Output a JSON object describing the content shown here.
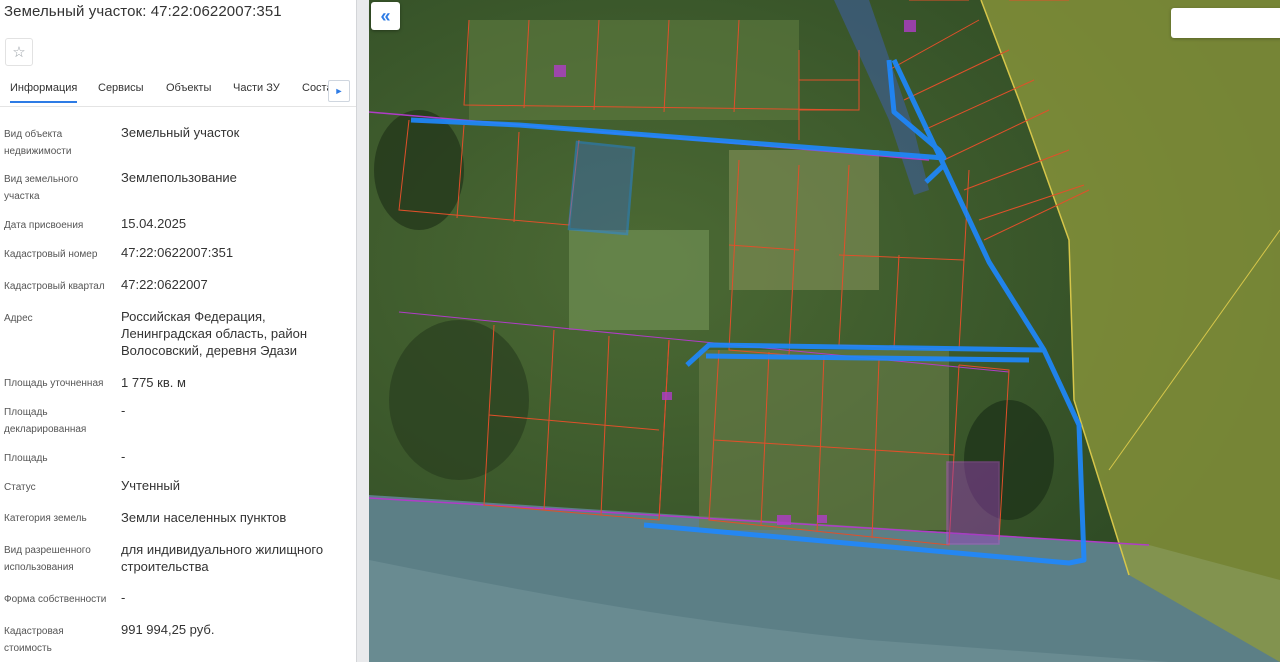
{
  "panel": {
    "title": "Земельный участок: 47:22:0622007:351",
    "favorite_icon": "star-icon",
    "tabs": [
      "Информация",
      "Сервисы",
      "Объекты",
      "Части ЗУ",
      "Соста"
    ],
    "tabs_next_icon": "chevron-right-icon",
    "rows": [
      {
        "label": "Вид объекта недвижимости",
        "value": "Земельный участок"
      },
      {
        "label": "Вид земельного участка",
        "value": "Землепользование"
      },
      {
        "label": "Дата присвоения",
        "value": "15.04.2025"
      },
      {
        "label": "Кадастровый номер",
        "value": "47:22:0622007:351"
      },
      {
        "label": "Кадастровый квартал",
        "value": "47:22:0622007"
      },
      {
        "label": "Адрес",
        "value": "Российская Федерация, Ленинградская область, район Волосовский, деревня Эдази"
      },
      {
        "label": "Площадь уточненная",
        "value": "1 775 кв. м"
      },
      {
        "label": "Площадь декларированная",
        "value": "-"
      },
      {
        "label": "Площадь",
        "value": "-"
      },
      {
        "label": "Статус",
        "value": "Учтенный"
      },
      {
        "label": "Категория земель",
        "value": "Земли населенных пунктов"
      },
      {
        "label": "Вид разрешенного использования",
        "value": "для индивидуального жилищного строительства"
      },
      {
        "label": "Форма собственности",
        "value": "-"
      },
      {
        "label": "Кадастровая стоимость",
        "value": "991 994,25 руб."
      }
    ]
  },
  "map": {
    "collapse_icon": "double-chevron-left-icon",
    "colors": {
      "parcel_border": "#e0502a",
      "highlight_outline": "#1e88ff",
      "forest_zone_fill": "#c8c85a",
      "pink_zone": "#b03cc8"
    }
  }
}
